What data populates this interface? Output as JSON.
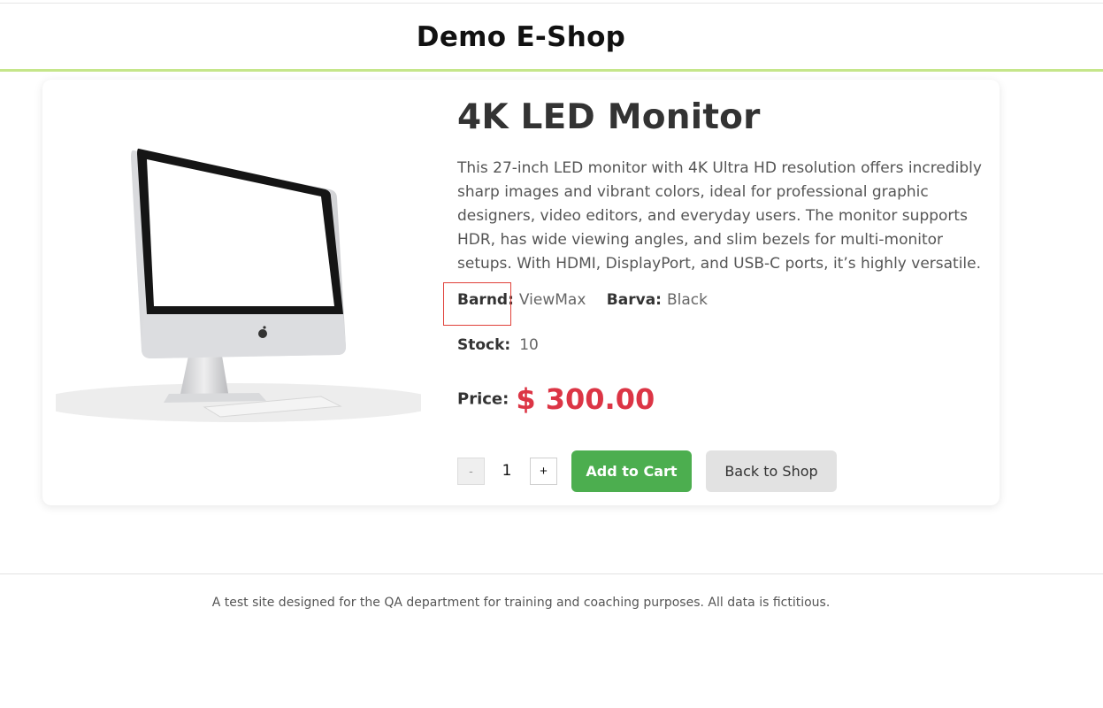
{
  "header": {
    "title": "Demo E-Shop"
  },
  "product": {
    "name": "4K LED Monitor",
    "description": "This 27-inch LED monitor with 4K Ultra HD resolution offers incredibly sharp images and vibrant colors, ideal for professional graphic designers, video editors, and everyday users. The monitor supports HDR, has wide viewing angles, and slim bezels for multi-monitor setups. With HDMI, DisplayPort, and USB-C ports, it’s highly versatile.",
    "brand_label": "Barnd:",
    "brand_value": "ViewMax",
    "color_label": "Barva:",
    "color_value": "Black",
    "stock_label": "Stock:",
    "stock_value": "10",
    "price_label": "Price:",
    "price_value": "$ 300.00",
    "image_icon": "monitor-image"
  },
  "cart": {
    "minus_label": "-",
    "quantity": "1",
    "plus_label": "+",
    "add_label": "Add to Cart",
    "back_label": "Back to Shop"
  },
  "footer": {
    "text": "A test site designed for the QA department for training and coaching purposes. All data is fictitious."
  },
  "colors": {
    "accent_green": "#4cae4f",
    "price_red": "#dc3545",
    "header_border": "#c5e68a",
    "highlight_red": "#e0413a"
  }
}
